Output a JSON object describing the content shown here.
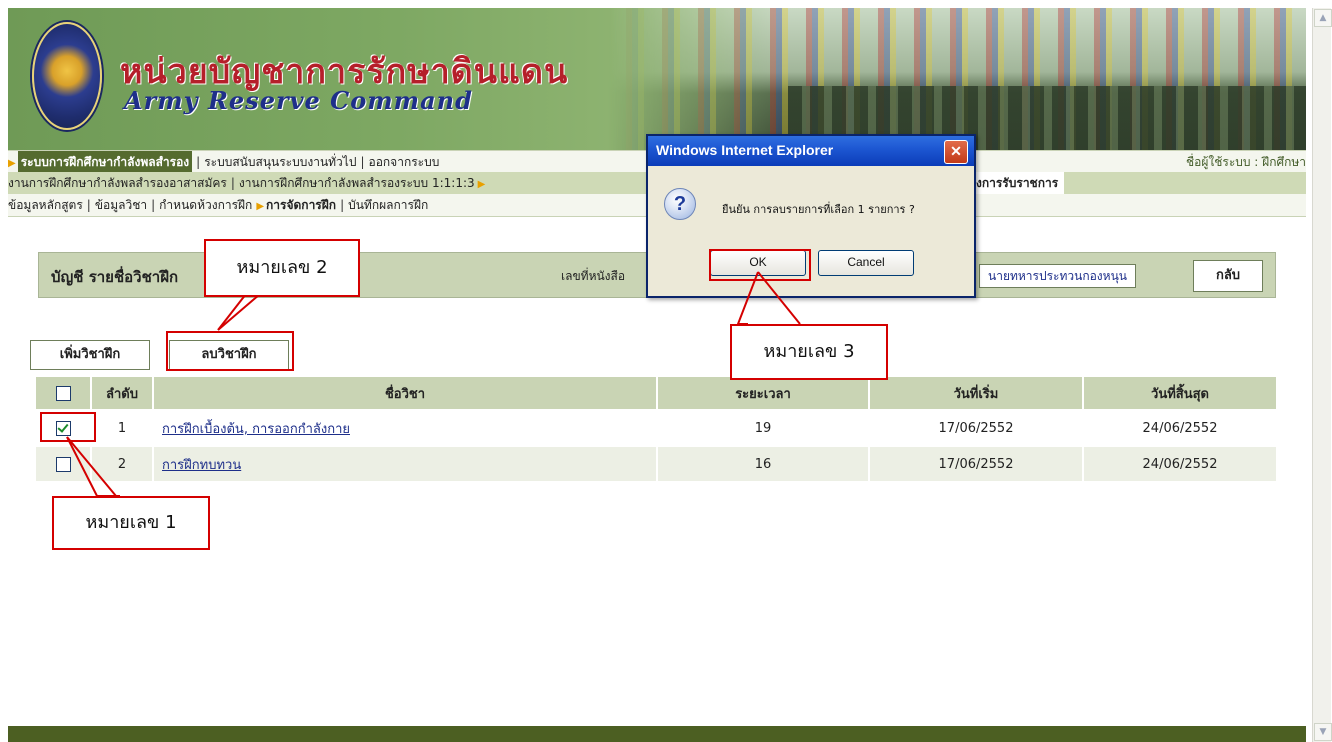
{
  "banner": {
    "title_th": "หน่วยบัญชาการรักษาดินแดน",
    "title_en": "Army Reserve Command"
  },
  "menu1": {
    "items": [
      "ระบบการฝึกศึกษากำลังพลสำรอง",
      "ระบบสนับสนุนระบบงานทั่วไป",
      "ออกจากระบบ"
    ],
    "user_label": "ชื่อผู้ใช้ระบบ : ฝึกศึกษา"
  },
  "menu2": {
    "items": [
      "งานการฝึกศึกษากำลังพลสำรองอาสาสมัคร",
      "งานการฝึกศึกษากำลังพลสำรองระบบ 1:1:1:3"
    ],
    "right_item": "งการรับราชการ"
  },
  "menu3": {
    "items": [
      "ข้อมูลหลักสูตร",
      "ข้อมูลวิชา",
      "กำหนดห้วงการฝึก",
      "การจัดการฝึก",
      "บันทึกผลการฝึก"
    ]
  },
  "header": {
    "title": "บัญชี รายชื่อวิชาฝึก",
    "doc_label": "เลขที่หนังสือ",
    "reserve_button": "นายทหารประทวนกองหนุน",
    "back_button": "กลับ"
  },
  "actions": {
    "add_label": "เพิ่มวิชาฝึก",
    "delete_label": "ลบวิชาฝึก"
  },
  "table": {
    "headers": [
      "",
      "ลำดับ",
      "ชื่อวิชา",
      "ระยะเวลา",
      "วันที่เริ่ม",
      "วันที่สิ้นสุด"
    ],
    "rows": [
      {
        "checked": true,
        "no": "1",
        "name": "การฝึกเบื้องต้น, การออกกำลังกาย",
        "duration": "19",
        "start": "17/06/2552",
        "end": "24/06/2552"
      },
      {
        "checked": false,
        "no": "2",
        "name": "การฝึกทบทวน",
        "duration": "16",
        "start": "17/06/2552",
        "end": "24/06/2552"
      }
    ]
  },
  "dialog": {
    "title": "Windows Internet Explorer",
    "message": "ยืนยัน การลบรายการที่เลือก 1 รายการ ?",
    "ok_label": "OK",
    "cancel_label": "Cancel",
    "icon": "question-icon"
  },
  "annotations": {
    "label1": "หมายเลข 1",
    "label2": "หมายเลข 2",
    "label3": "หมายเลข 3"
  },
  "colors": {
    "menu_active": "#556b2f",
    "panel": "#c9d4b4",
    "annotation_red": "#d40000",
    "footer": "#4c5f22"
  }
}
